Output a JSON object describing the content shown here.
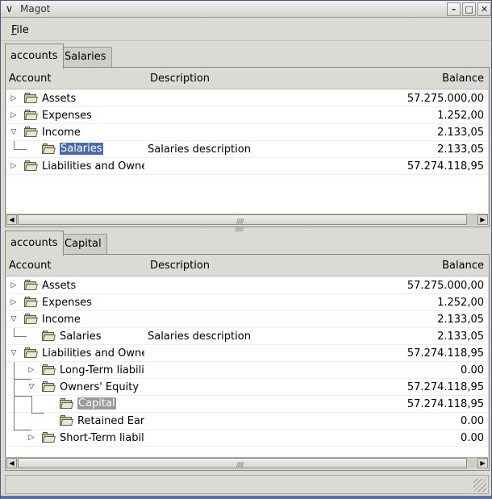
{
  "window": {
    "title": "Magot"
  },
  "menu": {
    "file_label": "File",
    "file_mnemonic": "F",
    "file_rest": "ile"
  },
  "columns": {
    "account": "Account",
    "description": "Description",
    "balance": "Balance"
  },
  "top_pane": {
    "tabs": [
      "accounts",
      "Salaries"
    ],
    "active_tab": "accounts",
    "rows": [
      {
        "name": "Assets",
        "description": "",
        "balance": "57.275.000,00",
        "expander": "collapsed",
        "selected": false
      },
      {
        "name": "Expenses",
        "description": "",
        "balance": "1.252,00",
        "expander": "collapsed",
        "selected": false
      },
      {
        "name": "Income",
        "description": "",
        "balance": "2.133,05",
        "expander": "expanded",
        "selected": false
      },
      {
        "name": "Salaries",
        "description": "Salaries description",
        "balance": "2.133,05",
        "expander": "none",
        "selected": true
      },
      {
        "name": "Liabilities and Owners'",
        "description": "",
        "balance": "57.274.118,95",
        "expander": "collapsed",
        "selected": false
      }
    ]
  },
  "bottom_pane": {
    "tabs": [
      "accounts",
      "Capital"
    ],
    "active_tab": "accounts",
    "rows": [
      {
        "name": "Assets",
        "description": "",
        "balance": "57.275.000,00",
        "expander": "collapsed",
        "selected": false
      },
      {
        "name": "Expenses",
        "description": "",
        "balance": "1.252,00",
        "expander": "collapsed",
        "selected": false
      },
      {
        "name": "Income",
        "description": "",
        "balance": "2.133,05",
        "expander": "expanded",
        "selected": false
      },
      {
        "name": "Salaries",
        "description": "Salaries description",
        "balance": "2.133,05",
        "expander": "none",
        "selected": false
      },
      {
        "name": "Liabilities and Owners'",
        "description": "",
        "balance": "57.274.118,95",
        "expander": "expanded",
        "selected": false
      },
      {
        "name": "Long-Term liabilitie",
        "description": "",
        "balance": "0.00",
        "expander": "collapsed",
        "selected": false
      },
      {
        "name": "Owners' Equity",
        "description": "",
        "balance": "57.274.118,95",
        "expander": "expanded",
        "selected": false
      },
      {
        "name": "Capital",
        "description": "",
        "balance": "57.274.118,95",
        "expander": "none",
        "selected": true
      },
      {
        "name": "Retained Earnings",
        "description": "",
        "balance": "0.00",
        "expander": "none",
        "selected": false
      },
      {
        "name": "Short-Term liabilitie",
        "description": "",
        "balance": "0.00",
        "expander": "collapsed",
        "selected": false
      }
    ]
  },
  "icons": {
    "window_menu": "chevron-down-icon",
    "minimize": "minimize-icon",
    "maximize": "maximize-icon",
    "close": "close-icon",
    "folder": "folder-open-icon",
    "expander_collapsed": "triangle-right-icon",
    "expander_expanded": "triangle-down-icon"
  },
  "colors": {
    "selection": "#4b6aa8",
    "selection_inactive": "#9a9a9a",
    "chrome": "#dcdad5"
  }
}
